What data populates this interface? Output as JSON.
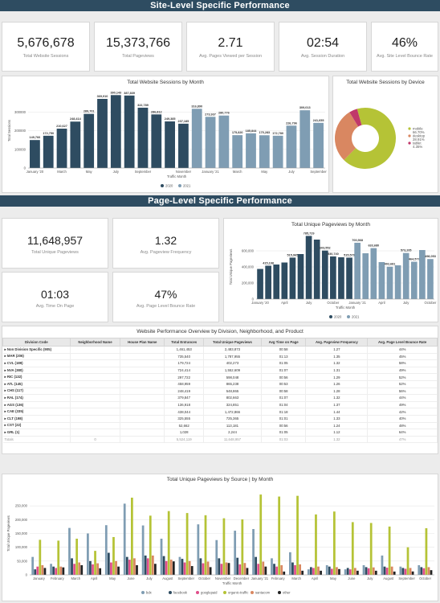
{
  "banners": {
    "site": "Site-Level Specific Performance",
    "page": "Page-Level Specific Performance"
  },
  "site_kpis": [
    {
      "value": "5,676,678",
      "label": "Total Website Sessions"
    },
    {
      "value": "15,373,766",
      "label": "Total Pageviews"
    },
    {
      "value": "2.71",
      "label": "Avg. Pages Viewed per Session"
    },
    {
      "value": "02:54",
      "label": "Avg. Session Duration"
    },
    {
      "value": "46%",
      "label": "Avg. Site Level Bounce Rate"
    }
  ],
  "page_kpis": [
    {
      "value": "11,648,957",
      "label": "Total Unique Pageviews"
    },
    {
      "value": "1.32",
      "label": "Avg. Pageview Frequency"
    },
    {
      "value": "01:03",
      "label": "Avg. Time On Page"
    },
    {
      "value": "47%",
      "label": "Avg. Page Level Bounce Rate"
    }
  ],
  "colors": {
    "y2020": "#2e4c61",
    "y2021": "#7f9db3",
    "mobile": "#b5c336",
    "desktop": "#d98761",
    "tablet": "#c0386a",
    "banner": "#2e4c61"
  },
  "table": {
    "title": "Website Performance Overview by Division, Neighborhood, and Product",
    "headers": [
      "Division Code",
      "Neighborhood Name",
      "House Plan Name",
      "Total Entrances",
      "Total Unique Pageviews",
      "Avg Time on Page",
      "Avg. Pageview Frequency",
      "Avg. Page Level Bounce Rate"
    ],
    "rows": [
      [
        "Non Division Specific (905)",
        "",
        "",
        "1,461,453",
        "2,483,873",
        "00:58",
        "1.27",
        "44%"
      ],
      [
        "MAR (206)",
        "",
        "",
        "735,540",
        "1,787,955",
        "01:13",
        "1.35",
        "45%"
      ],
      [
        "CVL (189)",
        "",
        "",
        "179,724",
        "402,273",
        "01:05",
        "1.32",
        "58%"
      ],
      [
        "NVA (380)",
        "",
        "",
        "724,414",
        "1,552,609",
        "01:07",
        "1.31",
        "49%"
      ],
      [
        "RIC (132)",
        "",
        "",
        "297,722",
        "598,048",
        "00:56",
        "1.29",
        "52%"
      ],
      [
        "ATL (145)",
        "",
        "",
        "458,959",
        "865,238",
        "00:53",
        "1.26",
        "52%"
      ],
      [
        "CHS (117)",
        "",
        "",
        "248,419",
        "548,865",
        "00:58",
        "1.28",
        "56%"
      ],
      [
        "RAL (174)",
        "",
        "",
        "379,847",
        "802,663",
        "01:07",
        "1.32",
        "44%"
      ],
      [
        "AGS (136)",
        "",
        "",
        "136,918",
        "324,851",
        "01:04",
        "1.37",
        "49%"
      ],
      [
        "CAE (335)",
        "",
        "",
        "438,044",
        "1,472,866",
        "01:18",
        "1.44",
        "42%"
      ],
      [
        "CLT (198)",
        "",
        "",
        "325,555",
        "725,365",
        "01:01",
        "1.33",
        "40%"
      ],
      [
        "CST (22)",
        "",
        "",
        "52,662",
        "113,181",
        "00:56",
        "1.24",
        "48%"
      ],
      [
        "GRL (1)",
        "",
        "",
        "1,028",
        "2,244",
        "01:05",
        "1.12",
        "64%"
      ]
    ],
    "totals": [
      "Totals",
      "0",
      "",
      "5,524,119",
      "11,648,957",
      "01:03",
      "1.32",
      "47%"
    ]
  },
  "chart_data": [
    {
      "type": "bar",
      "title": "Total Website Sessions by Month",
      "xlabel": "Traffic Month",
      "ylabel": "Total Sessions",
      "ylim": [
        0,
        400000
      ],
      "yticks": [
        "0",
        "100000",
        "200000",
        "300000"
      ],
      "categories": [
        "Jan 2020",
        "Feb 2020",
        "Mar 2020",
        "Apr 2020",
        "May 2020",
        "Jun 2020",
        "Jul 2020",
        "Aug 2020",
        "Sep 2020",
        "Oct 2020",
        "Nov 2020",
        "Dec 2020",
        "Jan 2021",
        "Feb 2021",
        "Mar 2021",
        "Apr 2021",
        "May 2021",
        "Jun 2021",
        "Jul 2021",
        "Aug 2021",
        "Sep 2021",
        "Oct 2021"
      ],
      "tick_labels": [
        "January '20",
        "March",
        "May",
        "July",
        "September",
        "November",
        "January '21",
        "March",
        "May",
        "July",
        "September"
      ],
      "values": [
        149766,
        172750,
        210627,
        248414,
        289701,
        369910,
        390143,
        387839,
        322789,
        286812,
        249385,
        237185,
        316890,
        273937,
        280776,
        175820,
        185844,
        175283,
        172780,
        226796,
        309013,
        241655
      ],
      "data_labels": [
        "149,766",
        "172,750",
        "210,627",
        "248,414",
        "289,701",
        "369,910",
        "390,143",
        "387,839",
        "322,789",
        "286,812",
        "249,385",
        "237,185",
        "316,890",
        "273,937",
        "280,776",
        "175,820",
        "185,844",
        "175,283",
        "172,780",
        "226,796",
        "309,013",
        "241,655"
      ],
      "year_split": 12,
      "legend": [
        "2020",
        "2021"
      ],
      "legend_position": "bottom"
    },
    {
      "type": "pie",
      "title": "Total Website Sessions by Device",
      "slices": [
        {
          "name": "mobile",
          "value": 66.7,
          "label": "66.70%"
        },
        {
          "name": "desktop",
          "value": 28.91,
          "label": "28.91%"
        },
        {
          "name": "tablet",
          "value": 4.35,
          "label": "4.35%"
        }
      ],
      "legend_position": "right"
    },
    {
      "type": "bar",
      "title": "Total Unique Pageviews by Month",
      "xlabel": "Traffic Month",
      "ylabel": "Total Unique Pageviews",
      "ylim": [
        0,
        800000
      ],
      "yticks": [
        "0",
        "200,000",
        "400,000",
        "600,000"
      ],
      "categories": [
        "Jan 2020",
        "Feb 2020",
        "Mar 2020",
        "Apr 2020",
        "May 2020",
        "Jun 2020",
        "Jul 2020",
        "Aug 2020",
        "Sep 2020",
        "Oct 2020",
        "Nov 2020",
        "Dec 2020",
        "Jan 2021",
        "Feb 2021",
        "Mar 2021",
        "Apr 2021",
        "May 2021",
        "Jun 2021",
        "Jul 2021",
        "Aug 2021",
        "Sep 2021",
        "Oct 2021"
      ],
      "tick_labels": [
        "January '20",
        "April",
        "July",
        "October",
        "January '21",
        "April",
        "July",
        "October"
      ],
      "values": [
        375000,
        415198,
        430000,
        455000,
        515965,
        560000,
        785729,
        740000,
        603552,
        530740,
        520000,
        515570,
        700568,
        570000,
        633680,
        460000,
        402681,
        420000,
        573205,
        464577,
        610000,
        498053
      ],
      "data_labels": [
        "",
        "415,198",
        "",
        "",
        "515,965",
        "",
        "785,729",
        "",
        "603,552",
        "530,740",
        "",
        "515,570",
        "700,568",
        "",
        "633,680",
        "",
        "402,681",
        "",
        "573,205",
        "464,577",
        "",
        "498,053"
      ],
      "year_split": 12,
      "legend": [
        "2020",
        "2021"
      ],
      "legend_position": "bottom"
    },
    {
      "type": "bar",
      "title": "Total Unique Pageviews by Source | by Month",
      "xlabel": "Traffic Month",
      "ylabel": "Total Unique Pageviews",
      "ylim": [
        0,
        300000
      ],
      "yticks": [
        "0",
        "50,000",
        "100,000",
        "150,000",
        "200,000",
        "250,000"
      ],
      "categories": [
        "January",
        "February",
        "March",
        "April",
        "May",
        "June",
        "July",
        "August",
        "September",
        "October",
        "November",
        "December",
        "January '21",
        "February",
        "March",
        "April",
        "May",
        "June",
        "July",
        "August",
        "September",
        "October"
      ],
      "series": [
        {
          "name": "bdx",
          "values": [
            65000,
            40000,
            170000,
            150000,
            180000,
            257999,
            179000,
            131000,
            65000,
            183000,
            126000,
            160000,
            166000,
            60000,
            82000,
            20000,
            35000,
            20000,
            35000,
            70000,
            30000,
            35000
          ]
        },
        {
          "name": "facebook",
          "values": [
            20000,
            30000,
            60000,
            50000,
            80000,
            65000,
            70000,
            68000,
            58000,
            60000,
            60000,
            62000,
            65000,
            40000,
            45000,
            28000,
            30000,
            25000,
            28000,
            30000,
            25000,
            28000
          ]
        },
        {
          "name": "googlepaid",
          "values": [
            30000,
            25000,
            40000,
            38000,
            45000,
            55000,
            60000,
            50000,
            45000,
            42000,
            40000,
            38000,
            40000,
            30000,
            35000,
            25000,
            22000,
            20000,
            24000,
            26000,
            22000,
            24000
          ]
        },
        {
          "name": "organic-traffic",
          "values": [
            127000,
            124000,
            131000,
            87000,
            137000,
            279674,
            214500,
            231000,
            224000,
            216000,
            205000,
            201000,
            291019,
            283707,
            286384,
            218947,
            229464,
            191013,
            188000,
            175000,
            100000,
            169000
          ]
        },
        {
          "name": "santacom",
          "values": [
            35000,
            30000,
            45000,
            42000,
            50000,
            60000,
            70000,
            55000,
            50000,
            48000,
            45000,
            43000,
            48000,
            35000,
            38000,
            30000,
            28000,
            25000,
            27000,
            30000,
            25000,
            28000
          ]
        },
        {
          "name": "other",
          "values": [
            25000,
            27104,
            34994,
            24000,
            30000,
            35000,
            40000,
            48858,
            31857,
            28000,
            42988,
            25000,
            30000,
            12000,
            15000,
            15000,
            20993,
            15000,
            14974,
            12000,
            12343,
            17000
          ]
        }
      ],
      "legend_position": "bottom"
    }
  ]
}
